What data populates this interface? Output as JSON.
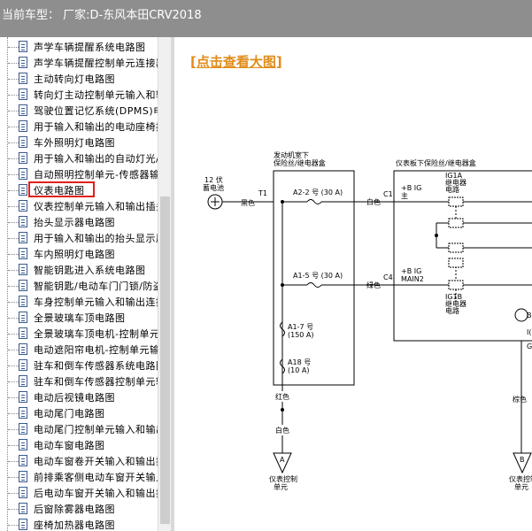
{
  "titlebar": {
    "text": "当前车型： 厂家:D-东风本田CRV2018"
  },
  "sidebar": {
    "items": [
      "声学车辆提醒系统电路图",
      "声学车辆提醒控制单元连接器",
      "主动转向灯电路图",
      "转向灯主动控制单元输入和输",
      "驾驶位置记忆系统(DPMS)电",
      "用于输入和输出的电动座椅控",
      "车外照明灯电路图",
      "用于输入和输出的自动灯光/",
      "自动照明控制单元-传感器输",
      "仪表电路图",
      "仪表控制单元输入和输出插头",
      "抬头显示器电路图",
      "用于输入和输出的抬头显示屏",
      "车内照明灯电路图",
      "智能钥匙进入系统电路图",
      "智能钥匙/电动车门门锁/防盗",
      "车身控制单元输入和输出连接",
      "全景玻璃车顶电路图",
      "全景玻璃车顶电机-控制单元",
      "电动遮阳帘电机-控制单元输",
      "驻车和倒车传感器系统电路图",
      "驻车和倒车传感器控制单元输",
      "电动后视镜电路图",
      "电动尾门电路图",
      "电动尾门控制单元输入和输出",
      "电动车窗电路图",
      "电动车窗卷开关输入和输出插",
      "前排乘客侧电动车窗开关输入",
      "后电动车窗开关输入和输出插",
      "后窗除雾器电路图",
      "座椅加热器电路图"
    ],
    "selected_index": 9
  },
  "main": {
    "link_text": "[点击查看大图]",
    "diagram": {
      "battery_label_1": "12 伏",
      "battery_label_2": "蓄电池",
      "box1_title_1": "发动机室下",
      "box1_title_2": "保险丝/继电器盒",
      "box2_title": "仪表板下保险丝/继电器盒",
      "t1": "T1",
      "wire_black": "黑色",
      "fuse_a22": "A2-2 号 (30 A)",
      "fuse_a15": "A1-5 号 (30 A)",
      "fuse_a17_1": "A1-7 号",
      "fuse_a17_2": "(150 A)",
      "fuse_a18_1": "A18 号",
      "fuse_a18_2": "(10 A)",
      "c1": "C1",
      "c4": "C4",
      "wire_white": "白色",
      "wire_green": "绿色",
      "wire_red": "红色",
      "wire_white2": "白色",
      "wire_brown": "棕色",
      "bplus_ig_1": "+B IG",
      "bplus_ig_2": "主",
      "bplus_main2_1": "+B IG",
      "bplus_main2_2": "MAIN2",
      "ig1a_1": "IG1A",
      "ig1a_2": "继电器",
      "ig1a_3": "电路",
      "ig1b_1": "IG1B",
      "ig1b_2": "继电器",
      "ig1b_3": "电路",
      "conn_a": "A",
      "conn_b": "B",
      "unit_1": "仪表控制",
      "unit_2": "单元",
      "unit_b_1": "仪表控制",
      "unit_b_2": "单元",
      "edge_b": "B",
      "edge_i": "I(",
      "edge_g": "G"
    }
  }
}
